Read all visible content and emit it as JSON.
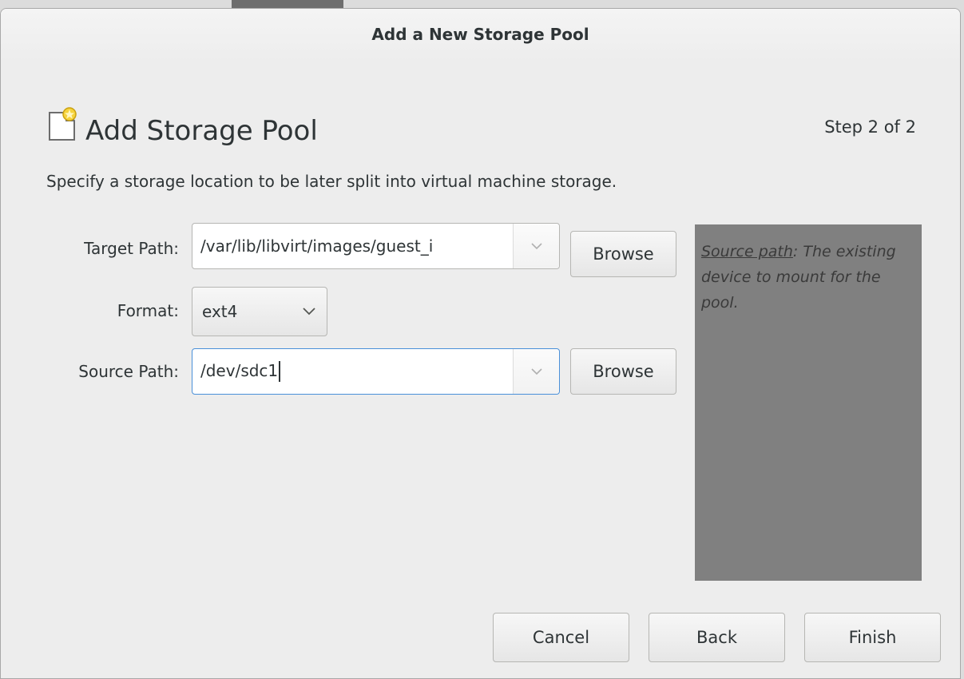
{
  "window": {
    "title": "Add a New Storage Pool"
  },
  "header": {
    "icon": "new-document-icon",
    "title": "Add Storage Pool",
    "step": "Step 2 of 2"
  },
  "description": "Specify a storage location to be later split into virtual machine storage.",
  "form": {
    "target_path": {
      "label": "Target Path:",
      "value": "/var/lib/libvirt/images/guest_i",
      "browse_label": "Browse"
    },
    "format": {
      "label": "Format:",
      "selected": "ext4"
    },
    "source_path": {
      "label": "Source Path:",
      "value": "/dev/sdc1",
      "browse_label": "Browse"
    }
  },
  "help": {
    "term": "Source path",
    "text": ": The existing device to mount for the pool."
  },
  "buttons": {
    "cancel": "Cancel",
    "back": "Back",
    "finish": "Finish"
  },
  "colors": {
    "help_panel_bg": "#808080",
    "focus_border": "#4a90d9",
    "window_bg": "#ededed"
  }
}
